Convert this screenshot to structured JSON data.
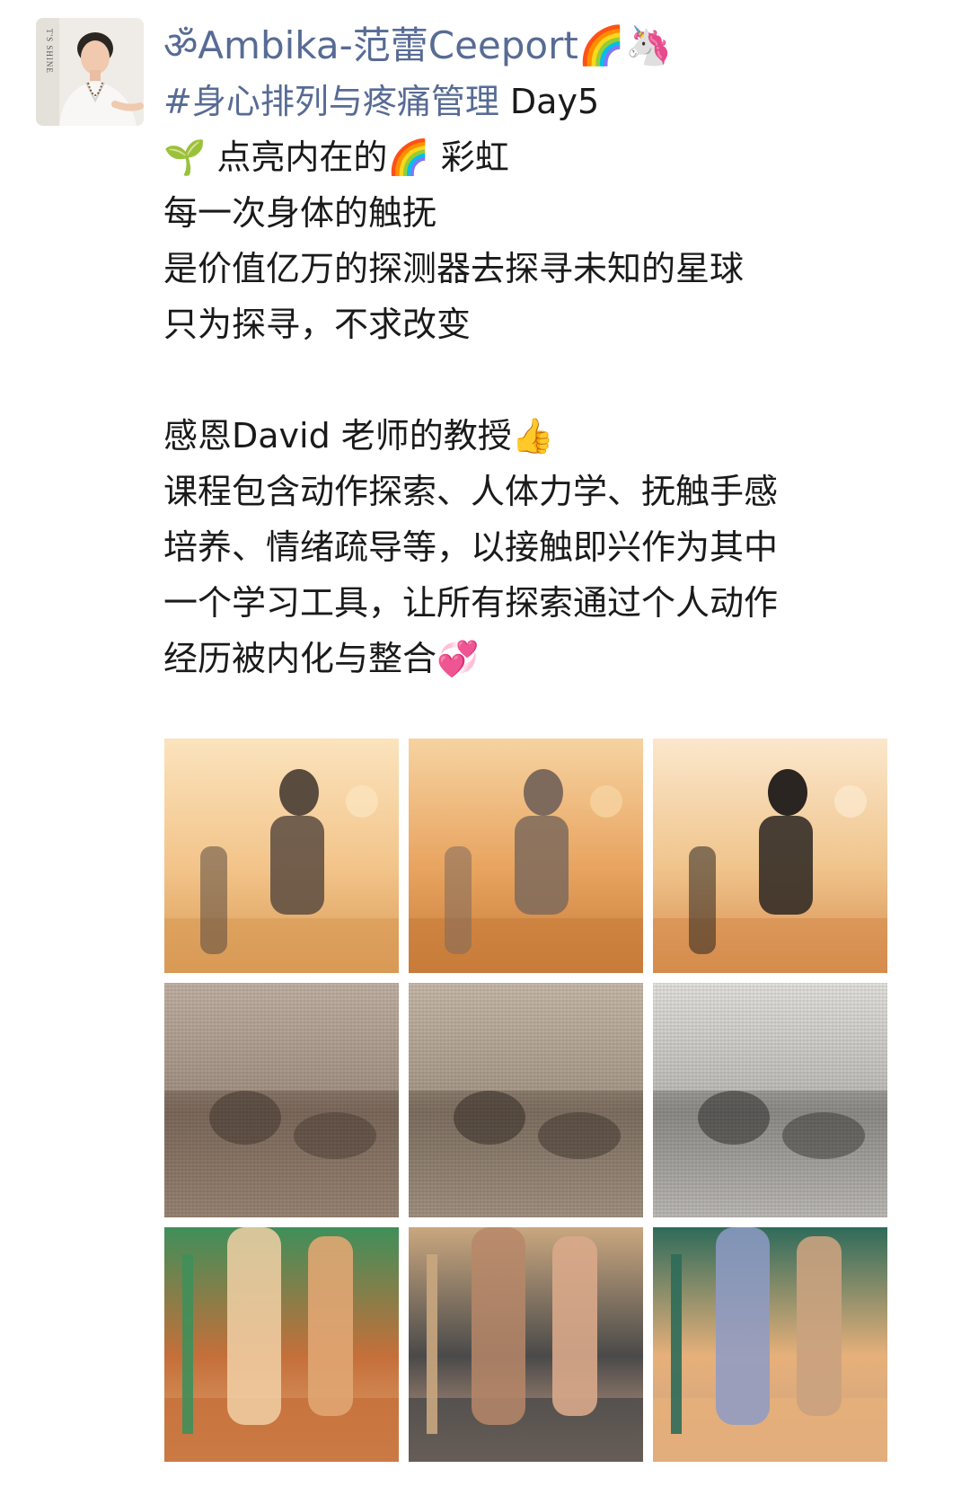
{
  "post": {
    "nickname": "ॐAmbika-范蕾Ceeport🌈🦄",
    "avatar_wall_text": "T'S SHINE",
    "lines": [
      {
        "hashtag": "#身心排列与疼痛管理",
        "text": " Day5"
      },
      {
        "text": "🌱 点亮内在的🌈 彩虹"
      },
      {
        "text": "每一次身体的触抚"
      },
      {
        "text": "是价值亿万的探测器去探寻未知的星球"
      },
      {
        "text": "只为探寻，不求改变"
      },
      {
        "text": ""
      },
      {
        "text": "感恩David 老师的教授👍"
      },
      {
        "text": "课程包含动作探索、人体力学、抚触手感"
      },
      {
        "text": "培养、情绪疏导等，以接触即兴作为其中"
      },
      {
        "text": "一个学习工具，让所有探索通过个人动作"
      },
      {
        "text": "经历被内化与整合💞"
      }
    ],
    "photos": [
      {
        "name": "photo-partners-dancing",
        "palette": [
          "#f3c48a",
          "#d89a55",
          "#5a4b3f",
          "#fbe3bd"
        ]
      },
      {
        "name": "photo-studio-walking",
        "palette": [
          "#e8a460",
          "#c87c3a",
          "#7e6a5c",
          "#f6d3a1"
        ]
      },
      {
        "name": "photo-smiling-participants",
        "palette": [
          "#f0c48c",
          "#d68c4c",
          "#2a2521",
          "#fbe7cc"
        ]
      },
      {
        "name": "photo-room-through-screen-1",
        "palette": [
          "#7d6a5c",
          "#9a8574",
          "#4b3e36",
          "#c1b2a4"
        ]
      },
      {
        "name": "photo-room-through-screen-2",
        "palette": [
          "#7f7061",
          "#a29282",
          "#3f352f",
          "#c8baa9"
        ]
      },
      {
        "name": "photo-leaf-shadow-screen",
        "palette": [
          "#8e8c88",
          "#bdbab6",
          "#3a3a38",
          "#e3e1dd"
        ]
      },
      {
        "name": "photo-stretching-by-door",
        "palette": [
          "#c56f3a",
          "#e0a673",
          "#f1d0a6",
          "#3f8f5a"
        ]
      },
      {
        "name": "photo-holding-hands",
        "palette": [
          "#4a4a4a",
          "#d9a98a",
          "#b78768",
          "#c9a77f"
        ]
      },
      {
        "name": "photo-walking-feet",
        "palette": [
          "#e7b07a",
          "#caa27f",
          "#8e9bc7",
          "#2e6b5a"
        ]
      }
    ]
  }
}
